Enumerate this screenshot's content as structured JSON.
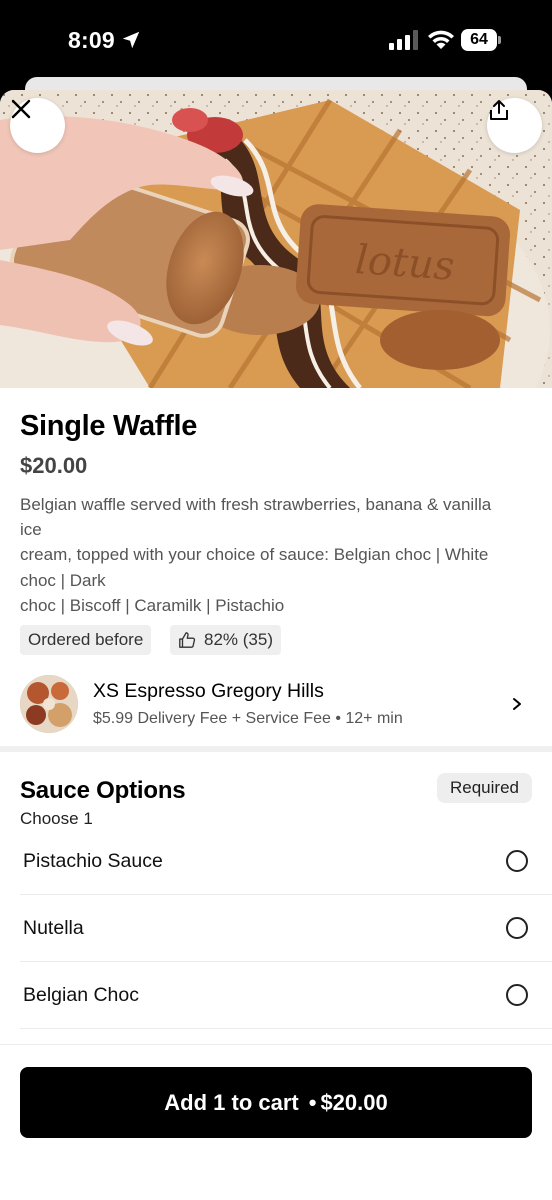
{
  "status_bar": {
    "time": "8:09",
    "battery": "64"
  },
  "item": {
    "title": "Single Waffle",
    "price": "$20.00",
    "description_lines": [
      "Belgian waffle served with fresh strawberries, banana & vanilla",
      "ice",
      "cream, topped with your choice of sauce: Belgian choc | White",
      "choc | Dark",
      "choc | Biscoff | Caramilk | Pistachio"
    ],
    "ordered_before_label": "Ordered before",
    "rating_label": "82% (35)",
    "hero_text": "lotus"
  },
  "store": {
    "name": "XS Espresso Gregory Hills",
    "meta": "$5.99 Delivery Fee + Service Fee • 12+ min"
  },
  "options": {
    "title": "Sauce Options",
    "subtitle": "Choose 1",
    "required_label": "Required",
    "items": [
      {
        "label": "Pistachio Sauce"
      },
      {
        "label": "Nutella"
      },
      {
        "label": "Belgian Choc"
      }
    ]
  },
  "cart": {
    "label": "Add 1 to cart",
    "separator": "•",
    "price": "$20.00"
  },
  "icons": {
    "close": "close-icon",
    "share": "share-icon",
    "thumbs_up": "thumbs-up-icon",
    "chevron": "chevron-right-icon"
  }
}
